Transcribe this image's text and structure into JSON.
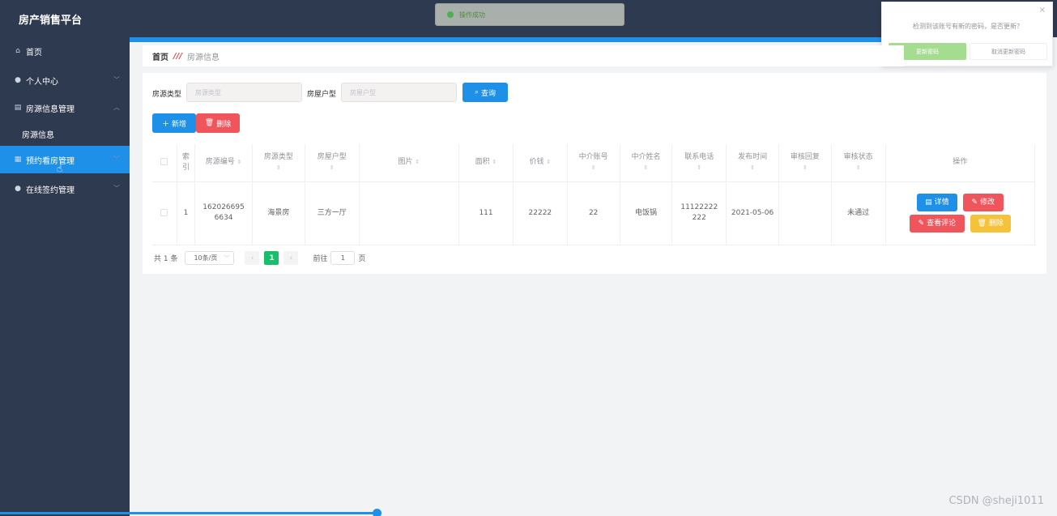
{
  "app": {
    "title": "房产销售平台"
  },
  "toast": {
    "text": "操作成功"
  },
  "popup": {
    "message": "检测到该账号有新的密码，是否更新？",
    "ok": "更新密码",
    "cancel": "取消更新密码",
    "close": "×"
  },
  "sidebar": {
    "items": [
      {
        "label": "首页",
        "icon": "home-icon"
      },
      {
        "label": "个人中心",
        "icon": "user-icon"
      },
      {
        "label": "房源信息管理",
        "icon": "clipboard-icon"
      },
      {
        "label": "房源信息",
        "icon": ""
      },
      {
        "label": "预约看房管理",
        "icon": "calendar-icon"
      },
      {
        "label": "在线签约管理",
        "icon": "user-icon"
      }
    ]
  },
  "breadcrumb": {
    "home": "首页",
    "current": "房源信息"
  },
  "search": {
    "type_label": "房源类型",
    "type_placeholder": "房源类型",
    "layout_label": "房屋户型",
    "layout_placeholder": "房屋户型",
    "query_button": "查询"
  },
  "toolbar": {
    "add": "新增",
    "delete": "删除"
  },
  "table": {
    "headers": {
      "index": "索引",
      "number": "房源编号",
      "type": "房源类型",
      "layout": "房屋户型",
      "image": "图片",
      "area": "面积",
      "price": "价钱",
      "agent_account": "中介账号",
      "agent_name": "中介姓名",
      "phone": "联系电话",
      "publish_time": "发布时间",
      "review_reply": "审核回复",
      "review_status": "审核状态",
      "actions": "操作"
    },
    "rows": [
      {
        "index": "1",
        "number": "1620266956634",
        "type": "海景房",
        "layout": "三方一厅",
        "image": "",
        "area": "111",
        "price": "22222",
        "agent_account": "22",
        "agent_name": "电饭锅",
        "phone": "11122222222",
        "publish_time": "2021-05-06",
        "review_reply": "",
        "review_status": "未通过",
        "detail": "详情",
        "edit": "修改",
        "comments": "查看评论",
        "delete": "删除"
      }
    ]
  },
  "pagination": {
    "total": "共 1 条",
    "page_size": "10条/页",
    "current": "1",
    "goto_label": "前往",
    "goto_value": "1",
    "goto_suffix": "页"
  },
  "watermark": "CSDN @sheji1011"
}
